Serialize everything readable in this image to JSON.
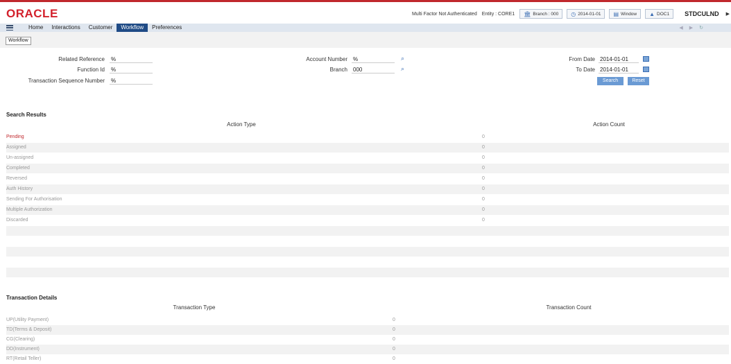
{
  "header": {
    "logo": "ORACLE",
    "auth_status": "Multi Factor Not Authenticated",
    "entity": "Entity : CORE1",
    "branch": "Branch : 000",
    "date": "2014-01-01",
    "window": "Window",
    "doc": "DOC1",
    "user": "STDCULND",
    "brand_color": "#d3212c",
    "accent_color": "#1f4b86"
  },
  "menu": {
    "items": [
      "Home",
      "Interactions",
      "Customer",
      "Workflow",
      "Preferences"
    ],
    "active": "Workflow"
  },
  "tab": {
    "label": "Workflow"
  },
  "form": {
    "related_reference_label": "Related Reference",
    "related_reference_value": "%",
    "function_id_label": "Function Id",
    "function_id_value": "%",
    "txn_seq_label": "Transaction Sequence Number",
    "txn_seq_value": "%",
    "account_number_label": "Account Number",
    "account_number_value": "%",
    "branch_label": "Branch",
    "branch_value": "000",
    "from_date_label": "From Date",
    "from_date_value": "2014-01-01",
    "to_date_label": "To Date",
    "to_date_value": "2014-01-01",
    "search_button": "Search",
    "reset_button": "Reset"
  },
  "search_results": {
    "title": "Search Results",
    "columns": [
      "Action Type",
      "Action Count"
    ],
    "rows": [
      {
        "type": "Pending",
        "count": "0"
      },
      {
        "type": "Assigned",
        "count": "0"
      },
      {
        "type": "Un-assigned",
        "count": "0"
      },
      {
        "type": "Completed",
        "count": "0"
      },
      {
        "type": "Reversed",
        "count": "0"
      },
      {
        "type": "Auth History",
        "count": "0"
      },
      {
        "type": "Sending For Authorisation",
        "count": "0"
      },
      {
        "type": "Multiple Authorization",
        "count": "0"
      },
      {
        "type": "Discarded",
        "count": "0"
      }
    ]
  },
  "transaction_details": {
    "title": "Transaction Details",
    "columns": [
      "Transaction Type",
      "Transaction Count"
    ],
    "rows": [
      {
        "type": "UP(Utility Payment)",
        "count": "0"
      },
      {
        "type": "TD(Terms & Deposit)",
        "count": "0"
      },
      {
        "type": "CG(Clearing)",
        "count": "0"
      },
      {
        "type": "DD(Instrument)",
        "count": "0"
      },
      {
        "type": "RT(Retail Teller)",
        "count": "0"
      }
    ]
  }
}
